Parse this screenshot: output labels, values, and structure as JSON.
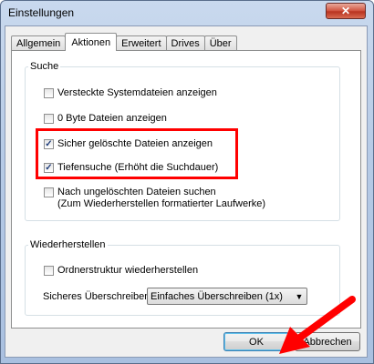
{
  "window": {
    "title": "Einstellungen",
    "close_symbol": "✕"
  },
  "tabs": [
    {
      "label": "Allgemein",
      "active": false
    },
    {
      "label": "Aktionen",
      "active": true
    },
    {
      "label": "Erweitert",
      "active": false
    },
    {
      "label": "Drives",
      "active": false
    },
    {
      "label": "Über",
      "active": false
    }
  ],
  "suche": {
    "legend": "Suche",
    "options": [
      {
        "label": "Versteckte Systemdateien anzeigen",
        "checked": false
      },
      {
        "label": "0 Byte Dateien anzeigen",
        "checked": false
      },
      {
        "label": "Sicher gelöschte Dateien anzeigen",
        "checked": true
      },
      {
        "label": "Tiefensuche (Erhöht die Suchdauer)",
        "checked": true
      },
      {
        "label": "Nach ungelöschten Dateien suchen\n(Zum Wiederherstellen formatierter Laufwerke)",
        "checked": false
      }
    ]
  },
  "wiederherstellen": {
    "legend": "Wiederherstellen",
    "ordnerstruktur": {
      "label": "Ordnerstruktur wiederherstellen",
      "checked": false
    },
    "ueberschreiben_label": "Sicheres Überschreiben",
    "ueberschreiben_value": "Einfaches Überschreiben (1x)"
  },
  "buttons": {
    "ok": "OK",
    "cancel": "Abbrechen"
  },
  "colors": {
    "highlight": "#ff0000",
    "arrow": "#ff0000"
  },
  "icons": {
    "checkmark": "✓",
    "dropdown": "▼"
  }
}
